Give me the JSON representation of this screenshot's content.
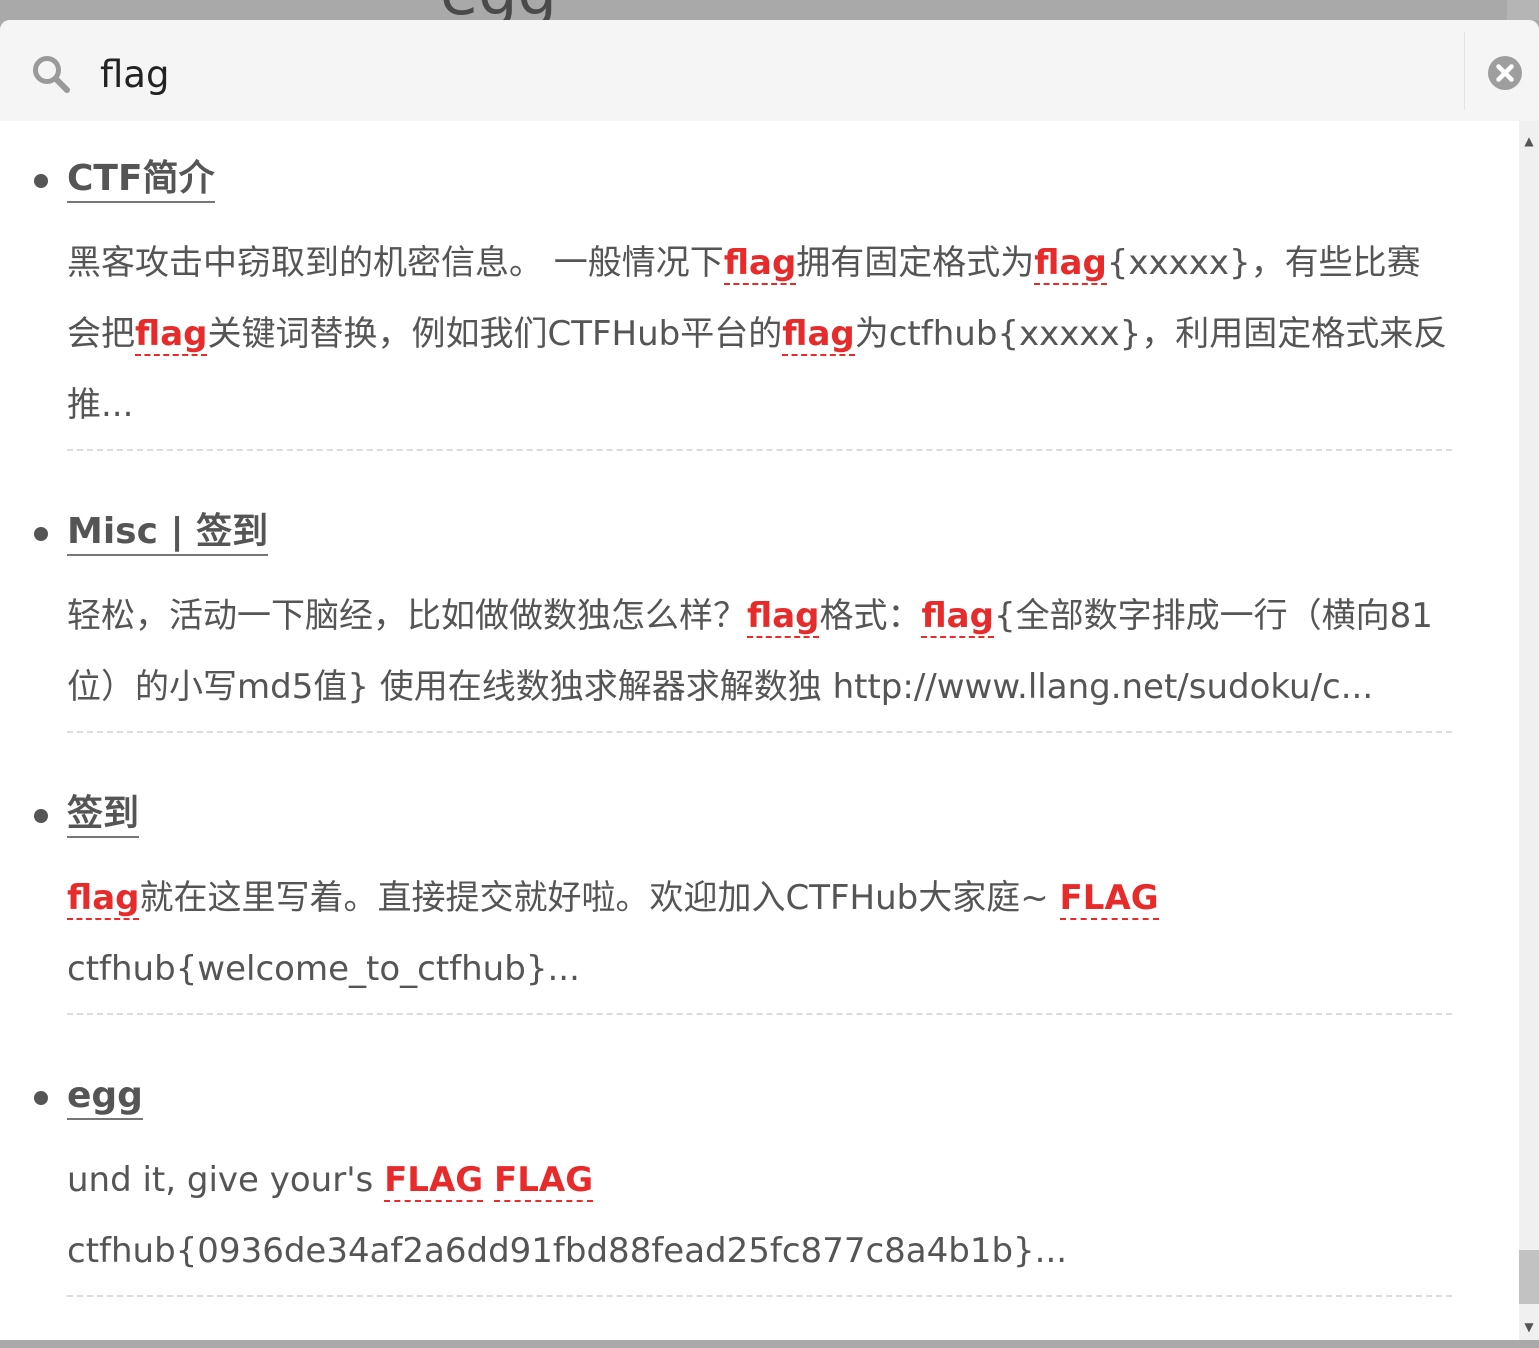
{
  "backdrop": {
    "title": "egg"
  },
  "search": {
    "query": "flag",
    "clear_label": "clear search"
  },
  "results": [
    {
      "title": "CTF简介",
      "excerpt_html": "黑客攻击中窃取到的机密信息。 一般情况下<span class=\"hl\">flag</span>拥有固定格式为<span class=\"hl\">flag</span>{xxxxx}，有些比赛会把<span class=\"hl\">flag</span>关键词替换，例如我们CTFHub平台的<span class=\"hl\">flag</span>为ctfhub{xxxxx}，利用固定格式来反推..."
    },
    {
      "title": "Misc | 签到",
      "excerpt_html": "轻松，活动一下脑经，比如做做数独怎么样？<span class=\"hl\">flag</span>格式：<span class=\"hl\">flag</span>{全部数字排成一行（横向81位）的小写md5值} 使用在线数独求解器求解数独 http://www.llang.net/sudoku/c..."
    },
    {
      "title": "签到",
      "excerpt_html": "<span class=\"hl\">flag</span>就在这里写着。直接提交就好啦。欢迎加入CTFHub大家庭~ <span class=\"hl\">FLAG</span> ctfhub{welcome_to_ctfhub}..."
    },
    {
      "title": "egg",
      "excerpt_html": "und it, give your's <span class=\"hl\">FLAG</span> <span class=\"hl\">FLAG</span> ctfhub{0936de34af2a6dd91fbd88fead25fc877c8a4b1b}..."
    }
  ],
  "colors": {
    "highlight": "#e72a2a",
    "text": "#555555",
    "search_bg": "#f5f5f5",
    "backdrop": "#a9a9a9"
  },
  "icons": {
    "search": "search-icon",
    "clear": "close-circle-icon"
  }
}
